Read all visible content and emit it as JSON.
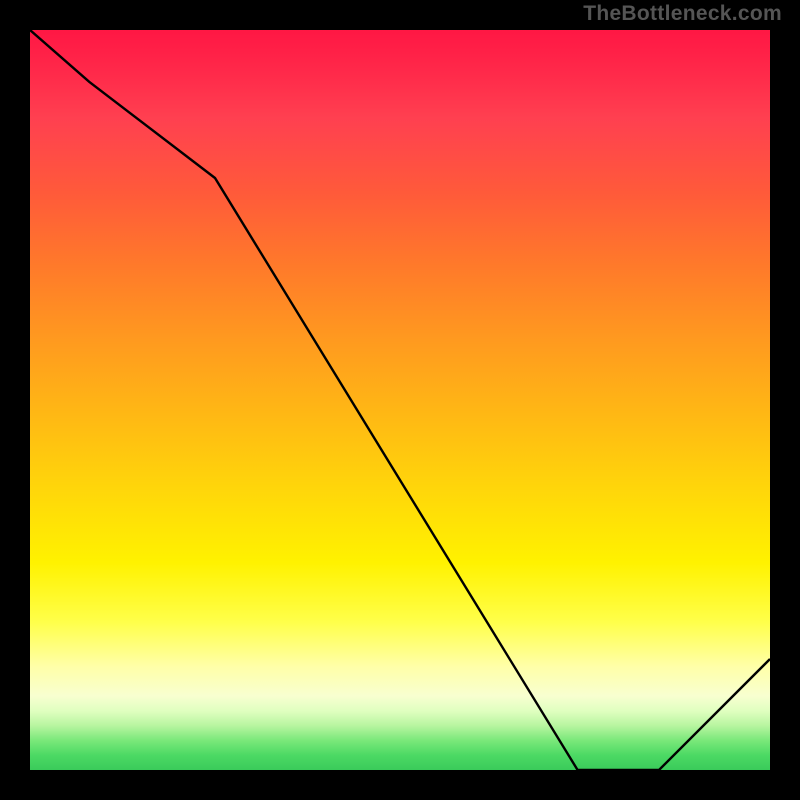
{
  "attribution": "TheBottleneck.com",
  "chart_data": {
    "type": "line",
    "title": "",
    "xlabel": "",
    "ylabel": "",
    "xlim": [
      0,
      100
    ],
    "ylim": [
      0,
      100
    ],
    "x": [
      0,
      8,
      25,
      74,
      85,
      100
    ],
    "y": [
      100,
      93,
      80,
      0,
      0,
      15
    ],
    "background_gradient": {
      "top": "#ff1744",
      "middle": "#ffd60a",
      "bottom": "#3acb5a"
    },
    "marker_region_x": [
      74,
      85
    ],
    "marker_label": ""
  }
}
